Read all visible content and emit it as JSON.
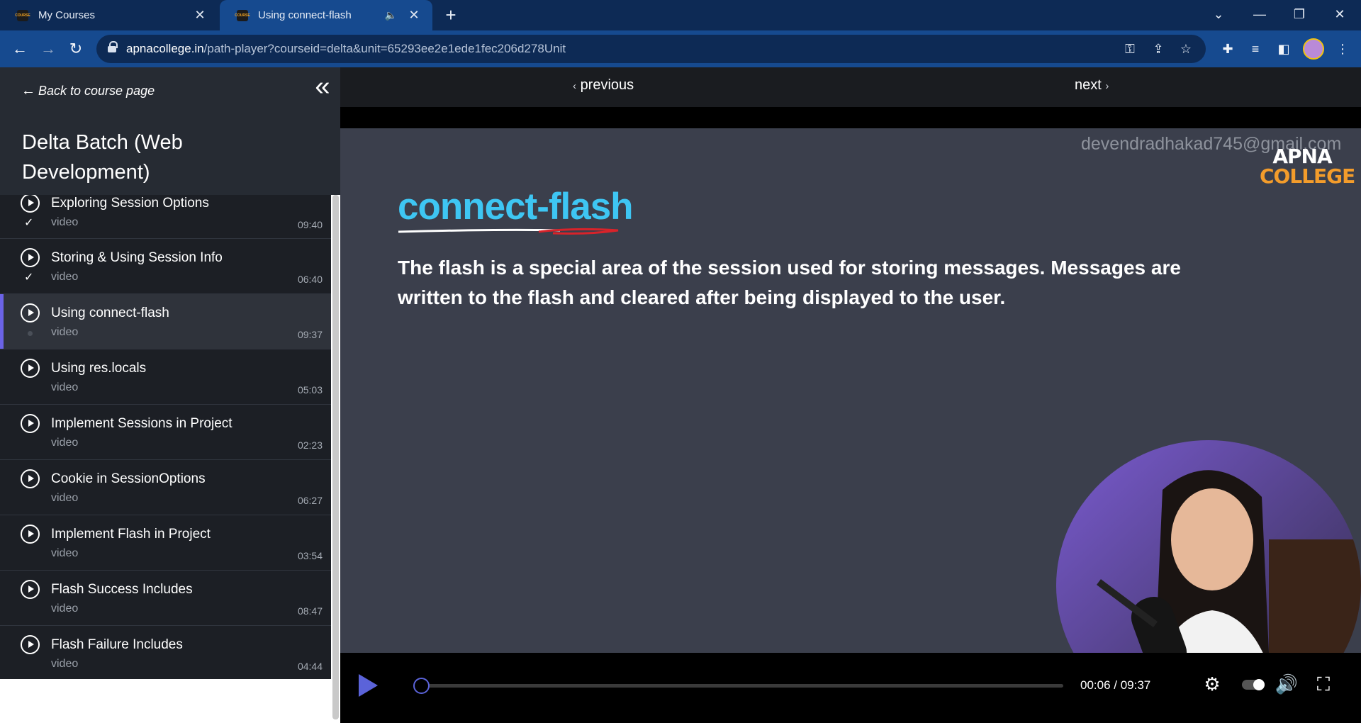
{
  "browser": {
    "tabs": [
      {
        "title": "My Courses",
        "active": false
      },
      {
        "title": "Using connect-flash",
        "active": true
      }
    ],
    "url_host": "apnacollege.in",
    "url_path": "/path-player?courseid=delta&unit=65293ee2e1ede1fec206d278Unit"
  },
  "sidebar": {
    "back_label": "Back to course page",
    "course_title": "Delta Batch (Web Development)",
    "lessons": [
      {
        "title": "Exploring Session Options",
        "type": "video",
        "duration": "09:40",
        "status": "done"
      },
      {
        "title": "Storing & Using Session Info",
        "type": "video",
        "duration": "06:40",
        "status": "done"
      },
      {
        "title": "Using connect-flash",
        "type": "video",
        "duration": "09:37",
        "status": "current"
      },
      {
        "title": "Using res.locals",
        "type": "video",
        "duration": "05:03",
        "status": "none"
      },
      {
        "title": "Implement Sessions in Project",
        "type": "video",
        "duration": "02:23",
        "status": "none"
      },
      {
        "title": "Cookie in SessionOptions",
        "type": "video",
        "duration": "06:27",
        "status": "none"
      },
      {
        "title": "Implement Flash in Project",
        "type": "video",
        "duration": "03:54",
        "status": "none"
      },
      {
        "title": "Flash Success Includes",
        "type": "video",
        "duration": "08:47",
        "status": "none"
      },
      {
        "title": "Flash Failure Includes",
        "type": "video",
        "duration": "04:44",
        "status": "none"
      }
    ],
    "done_mark": "✓"
  },
  "player": {
    "previous_label": "previous",
    "next_label": "next",
    "watermark": "devendradhakad745@gmail.com",
    "logo_line1": "APNA",
    "logo_line2": "COLLEGE",
    "heading": "connect-flash",
    "body": "The flash is a special area of the session used for storing messages. Messages are written to the flash and cleared after being displayed to the user.",
    "time": "00:06 / 09:37",
    "progress": 0.0103
  },
  "colors": {
    "accent": "#5b63d9",
    "heading": "#3ec6f3",
    "brand_orange": "#f39c2b"
  }
}
